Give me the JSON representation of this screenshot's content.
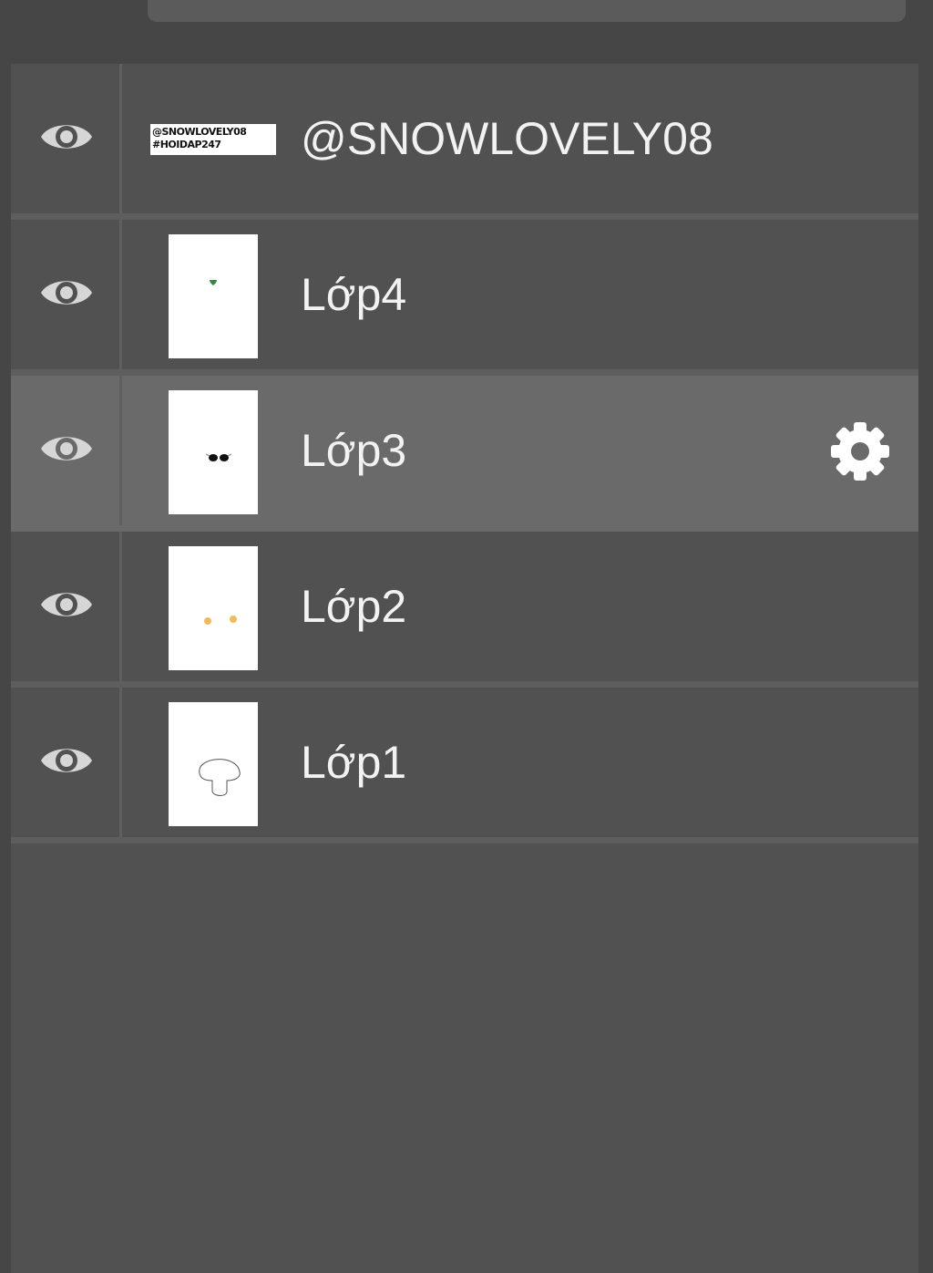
{
  "layers": [
    {
      "name": "@SNOWLOVELY08",
      "thumb_lines": [
        "@SNOWLOVELY08",
        "#HOIDAP247"
      ],
      "visible": true,
      "selected": false
    },
    {
      "name": "Lớp4",
      "visible": true,
      "selected": false
    },
    {
      "name": "Lớp3",
      "visible": true,
      "selected": true
    },
    {
      "name": "Lớp2",
      "visible": true,
      "selected": false
    },
    {
      "name": "Lớp1",
      "visible": true,
      "selected": false
    }
  ],
  "icons": {
    "visibility": "eye-icon",
    "settings": "gear-icon"
  },
  "colors": {
    "panel": "#515151",
    "selected_row": "#6a6a6a",
    "text": "#f2f2f2"
  }
}
